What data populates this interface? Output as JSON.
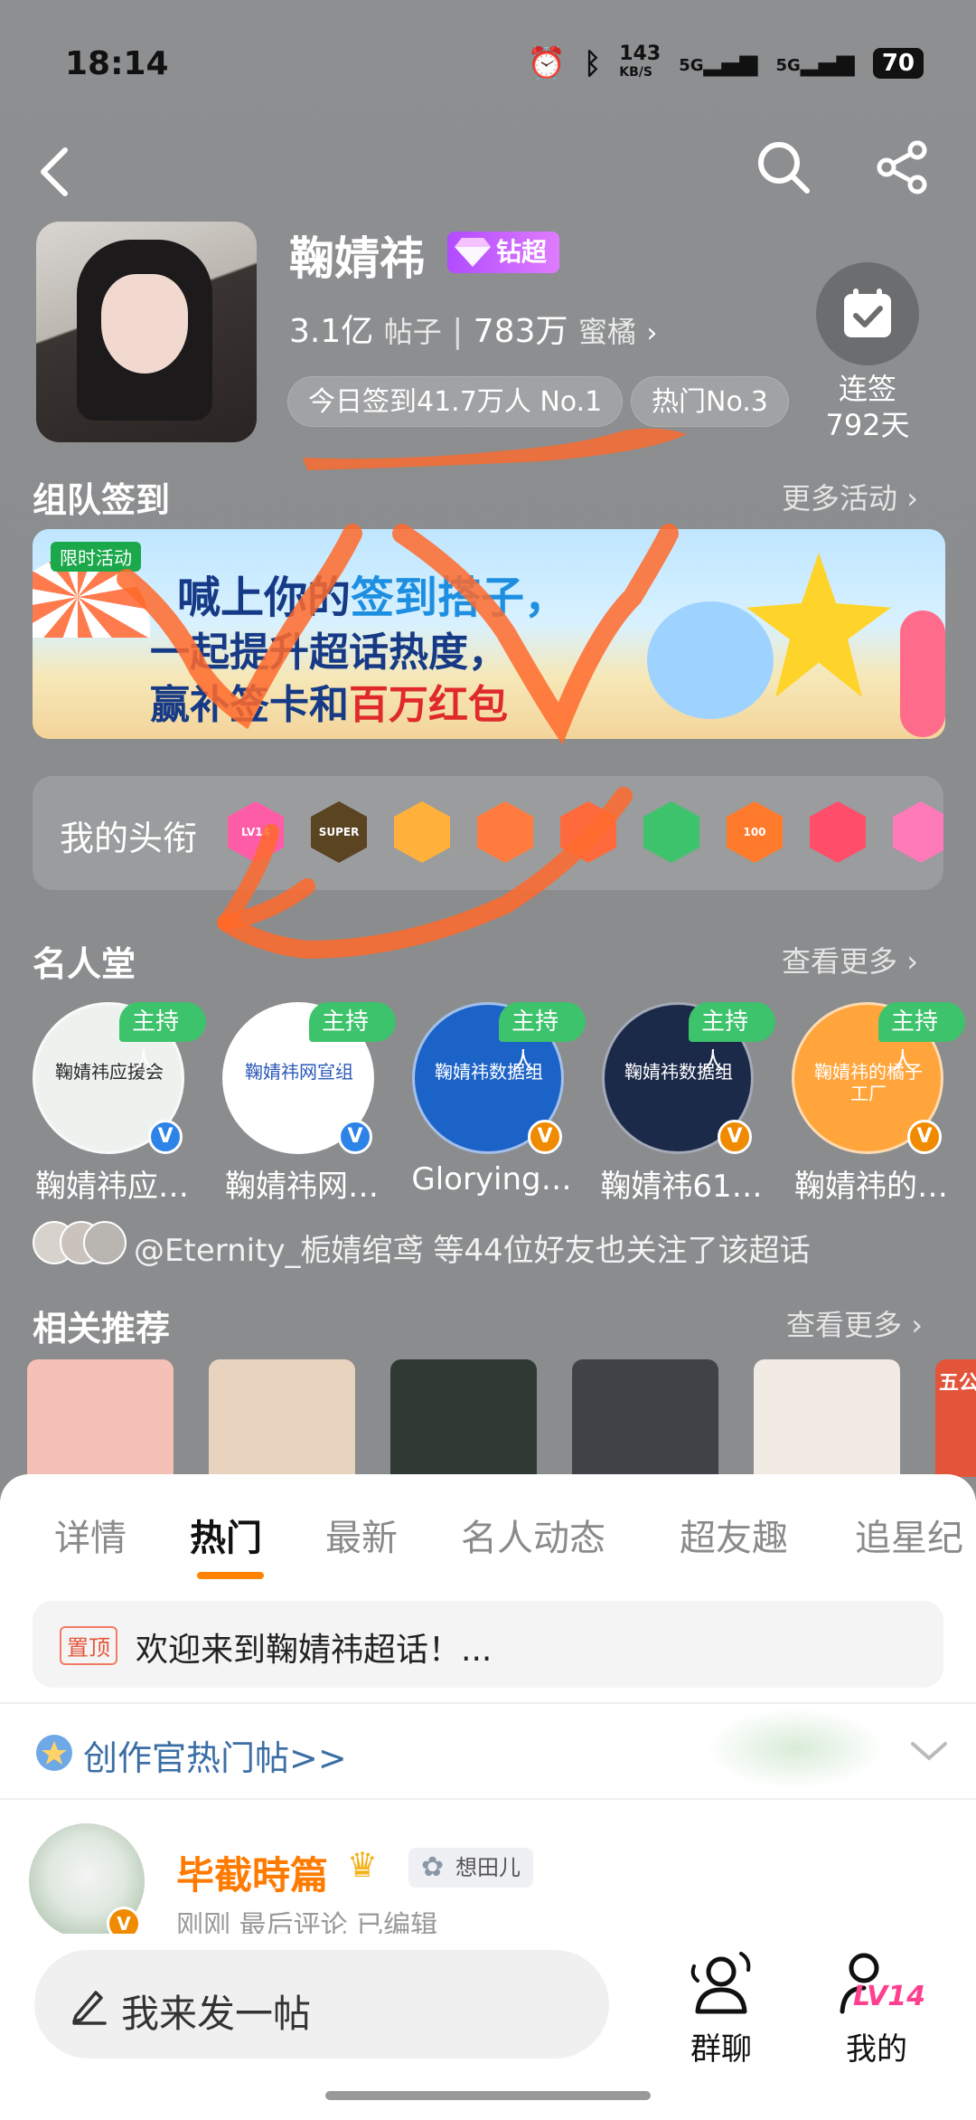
{
  "status_bar": {
    "time": "18:14",
    "net_speed_top": "143",
    "net_speed_unit": "KB/S",
    "sig1": "5G",
    "sig2": "5G",
    "battery": "70"
  },
  "header": {
    "title": "鞠婧祎",
    "diamond_badge": "钻超",
    "posts_count": "3.1亿",
    "posts_label": "帖子",
    "fans_count": "783万",
    "fans_label": "蜜橘",
    "checkin_today": "今日签到41.7万人 No.1",
    "hot_rank": "热门No.3",
    "streak_label": "连签",
    "streak_days": "792天"
  },
  "team_checkin": {
    "title": "组队签到",
    "more": "更多活动"
  },
  "banner": {
    "tag": "限时活动",
    "line1_a": "喊上你的",
    "line1_b": "签到搭子，",
    "line2": "一起提升超话热度，",
    "line3_a": "赢补签卡和",
    "line3_b": "百万红包"
  },
  "my_titles": {
    "label": "我的头衔",
    "badges": [
      {
        "text": "LV14",
        "color": "#ff5ca8",
        "icon": "lv14-badge-icon"
      },
      {
        "text": "SUPER",
        "color": "#5a4422",
        "icon": "super-crown-badge-icon"
      },
      {
        "text": "",
        "color": "#ffb13b",
        "icon": "crown-badge-icon"
      },
      {
        "text": "",
        "color": "#ff7a3c",
        "icon": "fox-badge-icon"
      },
      {
        "text": "",
        "color": "#ff6a3c",
        "icon": "bird-badge-icon"
      },
      {
        "text": "",
        "color": "#3cc36b",
        "icon": "hands-badge-icon"
      },
      {
        "text": "100",
        "color": "#ff7a2a",
        "icon": "100-days-badge-icon"
      },
      {
        "text": "",
        "color": "#ff4d6a",
        "icon": "trophy-badge-icon"
      },
      {
        "text": "",
        "color": "#ff7ab8",
        "icon": "wing-badge-icon"
      }
    ]
  },
  "hall_of_fame": {
    "title": "名人堂",
    "more": "查看更多",
    "host_tag": "主持人",
    "members": [
      {
        "name": "鞠婧祎应…",
        "verify": "V",
        "verify_color": "#2d83e8",
        "inner": "鞠婧祎应援会",
        "bg": "#eef2ef",
        "fg": "#2a2a2a"
      },
      {
        "name": "鞠婧祎网…",
        "verify": "V",
        "verify_color": "#2d83e8",
        "inner": "鞠婧祎网宣组",
        "bg": "#ffffff",
        "fg": "#2a58b8"
      },
      {
        "name": "Glorying…",
        "verify": "V",
        "verify_color": "#f08a00",
        "inner": "鞠婧祎数据组",
        "bg": "#1c63c8",
        "fg": "#ffffff"
      },
      {
        "name": "鞠婧祎61…",
        "verify": "V",
        "verify_color": "#f08a00",
        "inner": "鞠婧祎数据组",
        "bg": "#1c2a4a",
        "fg": "#ffffff"
      },
      {
        "name": "鞠婧祎的…",
        "verify": "V",
        "verify_color": "#f08a00",
        "inner": "鞠婧祎的橘子工厂",
        "bg": "#ffa53c",
        "fg": "#ffffff"
      }
    ]
  },
  "followers_note": "@Eternity_栀婧绾鸢 等44位好友也关注了该超话",
  "related": {
    "title": "相关推荐",
    "more": "查看更多",
    "thumb_colors": [
      "#f5c0b6",
      "#e8d3bf",
      "#2f3a35",
      "#3f4347",
      "#f1ebe4",
      "#e2553b"
    ],
    "partial_text": "五公"
  },
  "tabs": [
    "详情",
    "热门",
    "最新",
    "名人动态",
    "超友趣",
    "追星纪"
  ],
  "pinned": {
    "tag": "置顶",
    "text": "欢迎来到鞠婧祎超话！..."
  },
  "creator_hot": "创作官热门帖>>",
  "post": {
    "author": "毕截時篇",
    "group": "想田儿",
    "meta": "刚刚 最后评论  已编辑"
  },
  "bottom_bar": {
    "compose_placeholder": "我来发一帖",
    "group_chat": "群聊",
    "mine": "我的",
    "level": "LV14"
  }
}
